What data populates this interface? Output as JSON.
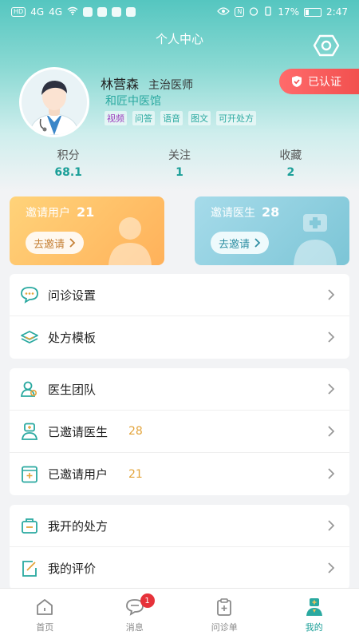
{
  "status_bar": {
    "left_chip": "HD",
    "signal_1": "4G",
    "signal_2": "4G",
    "battery": "17%",
    "time": "2:47"
  },
  "header": {
    "title": "个人中心"
  },
  "profile": {
    "name": "林营森",
    "title": "主治医师",
    "hospital": "和匠中医馆",
    "tags": [
      "视频",
      "问答",
      "语音",
      "图文",
      "可开处方"
    ],
    "verified_label": "已认证"
  },
  "stats": [
    {
      "label": "积分",
      "value": "68.1"
    },
    {
      "label": "关注",
      "value": "1"
    },
    {
      "label": "收藏",
      "value": "2"
    }
  ],
  "invite_cards": {
    "users": {
      "title": "邀请用户",
      "count": "21",
      "button": "去邀请"
    },
    "doctors": {
      "title": "邀请医生",
      "count": "28",
      "button": "去邀请"
    }
  },
  "menu_groups": [
    {
      "items": [
        {
          "label": "问诊设置"
        },
        {
          "label": "处方模板"
        }
      ]
    },
    {
      "items": [
        {
          "label": "医生团队"
        },
        {
          "label": "已邀请医生",
          "count": "28"
        },
        {
          "label": "已邀请用户",
          "count": "21"
        }
      ]
    },
    {
      "items": [
        {
          "label": "我开的处方"
        },
        {
          "label": "我的评价"
        }
      ]
    }
  ],
  "tabbar": {
    "tabs": [
      {
        "label": "首页"
      },
      {
        "label": "消息",
        "badge": "1"
      },
      {
        "label": "问诊单"
      },
      {
        "label": "我的"
      }
    ]
  },
  "colors": {
    "accent": "#1b9f98",
    "verified": "#f2504f",
    "count": "#e3a43b"
  }
}
